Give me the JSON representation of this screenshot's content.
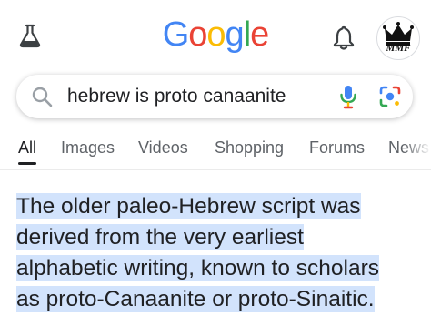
{
  "header": {
    "logo_letters": [
      {
        "char": "G",
        "color": "#4285F4"
      },
      {
        "char": "o",
        "color": "#EA4335"
      },
      {
        "char": "o",
        "color": "#FBBC05"
      },
      {
        "char": "g",
        "color": "#4285F4"
      },
      {
        "char": "l",
        "color": "#34A853"
      },
      {
        "char": "e",
        "color": "#EA4335"
      }
    ],
    "labs_icon": "flask-icon",
    "notifications_icon": "bell-icon",
    "avatar_text": "MMF"
  },
  "search": {
    "query": "hebrew is proto canaanite",
    "left_icon": "search-icon",
    "voice_icon": "mic-icon",
    "lens_icon": "lens-icon"
  },
  "tabs": [
    {
      "label": "All",
      "active": true
    },
    {
      "label": "Images",
      "active": false
    },
    {
      "label": "Videos",
      "active": false
    },
    {
      "label": "Shopping",
      "active": false
    },
    {
      "label": "Forums",
      "active": false
    },
    {
      "label": "News",
      "active": false
    }
  ],
  "snippet": {
    "lines": [
      "The older paleo-Hebrew script was",
      "derived from the very earliest",
      "alphabetic writing, known to scholars",
      "as proto-Canaanite or proto-Sinaitic."
    ],
    "highlight_color": "#d2e3fc"
  },
  "colors": {
    "text_primary": "#202124",
    "text_secondary": "#5f6368",
    "blue": "#4285F4",
    "red": "#EA4335",
    "yellow": "#FBBC05",
    "green": "#34A853"
  }
}
